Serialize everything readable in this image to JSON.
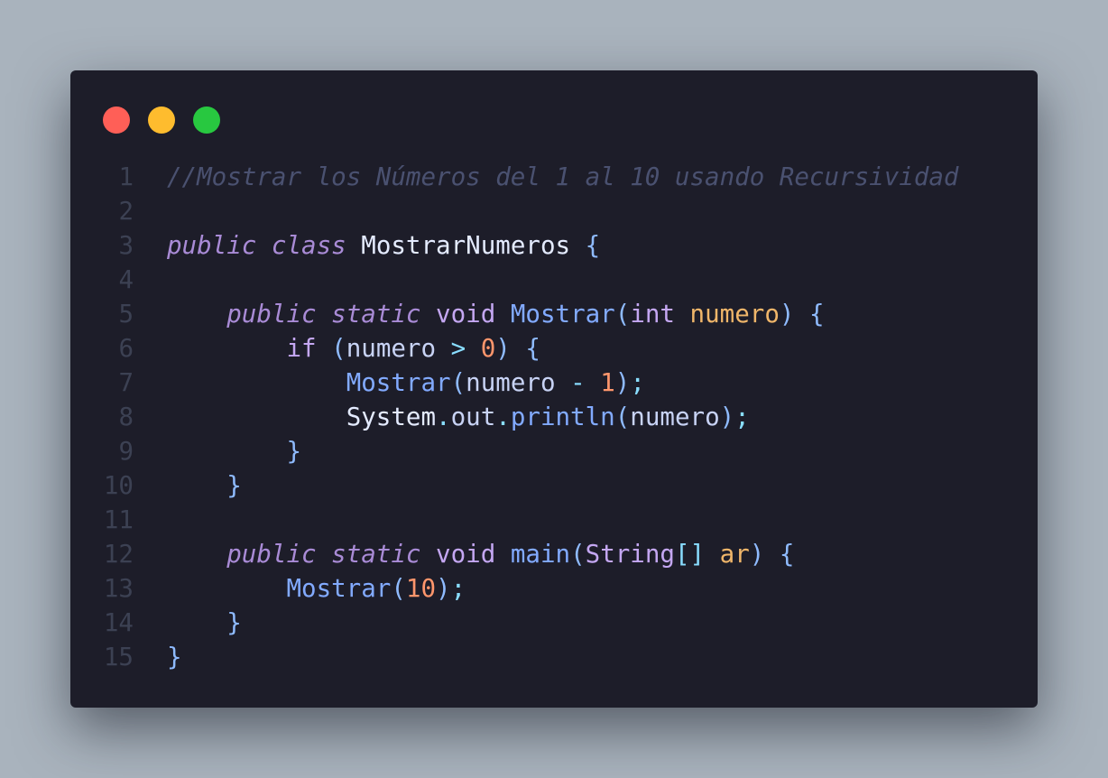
{
  "window": {
    "controls": [
      "close",
      "minimize",
      "maximize"
    ],
    "colors": {
      "background": "#1d1d29",
      "close": "#ff5f57",
      "minimize": "#febc2e",
      "maximize": "#28c840"
    }
  },
  "code": {
    "language": "java",
    "lines": [
      {
        "number": "1",
        "tokens": [
          {
            "t": "//Mostrar los Números del 1 al 10 usando Recursividad",
            "k": "comment"
          }
        ]
      },
      {
        "number": "2",
        "tokens": []
      },
      {
        "number": "3",
        "tokens": [
          {
            "t": "public",
            "k": "keyword"
          },
          {
            "t": " ",
            "k": "plain"
          },
          {
            "t": "class",
            "k": "keyword"
          },
          {
            "t": " ",
            "k": "plain"
          },
          {
            "t": "MostrarNumeros",
            "k": "class"
          },
          {
            "t": " ",
            "k": "plain"
          },
          {
            "t": "{",
            "k": "punct"
          }
        ]
      },
      {
        "number": "4",
        "tokens": []
      },
      {
        "number": "5",
        "tokens": [
          {
            "t": "    ",
            "k": "plain"
          },
          {
            "t": "public",
            "k": "keyword"
          },
          {
            "t": " ",
            "k": "plain"
          },
          {
            "t": "static",
            "k": "keyword"
          },
          {
            "t": " ",
            "k": "plain"
          },
          {
            "t": "void",
            "k": "type"
          },
          {
            "t": " ",
            "k": "plain"
          },
          {
            "t": "Mostrar",
            "k": "func"
          },
          {
            "t": "(",
            "k": "punct"
          },
          {
            "t": "int",
            "k": "type"
          },
          {
            "t": " ",
            "k": "plain"
          },
          {
            "t": "numero",
            "k": "param"
          },
          {
            "t": ")",
            "k": "punct"
          },
          {
            "t": " ",
            "k": "plain"
          },
          {
            "t": "{",
            "k": "punct"
          }
        ]
      },
      {
        "number": "6",
        "tokens": [
          {
            "t": "        ",
            "k": "plain"
          },
          {
            "t": "if",
            "k": "type"
          },
          {
            "t": " ",
            "k": "plain"
          },
          {
            "t": "(",
            "k": "punct"
          },
          {
            "t": "numero",
            "k": "plain"
          },
          {
            "t": " ",
            "k": "plain"
          },
          {
            "t": ">",
            "k": "op"
          },
          {
            "t": " ",
            "k": "plain"
          },
          {
            "t": "0",
            "k": "number"
          },
          {
            "t": ")",
            "k": "punct"
          },
          {
            "t": " ",
            "k": "plain"
          },
          {
            "t": "{",
            "k": "punct"
          }
        ]
      },
      {
        "number": "7",
        "tokens": [
          {
            "t": "            ",
            "k": "plain"
          },
          {
            "t": "Mostrar",
            "k": "func"
          },
          {
            "t": "(",
            "k": "punct"
          },
          {
            "t": "numero",
            "k": "plain"
          },
          {
            "t": " ",
            "k": "plain"
          },
          {
            "t": "-",
            "k": "op"
          },
          {
            "t": " ",
            "k": "plain"
          },
          {
            "t": "1",
            "k": "number"
          },
          {
            "t": ")",
            "k": "punct"
          },
          {
            "t": ";",
            "k": "op"
          }
        ]
      },
      {
        "number": "8",
        "tokens": [
          {
            "t": "            ",
            "k": "plain"
          },
          {
            "t": "System",
            "k": "class"
          },
          {
            "t": ".",
            "k": "op"
          },
          {
            "t": "out",
            "k": "plain"
          },
          {
            "t": ".",
            "k": "op"
          },
          {
            "t": "println",
            "k": "func"
          },
          {
            "t": "(",
            "k": "punct"
          },
          {
            "t": "numero",
            "k": "plain"
          },
          {
            "t": ")",
            "k": "punct"
          },
          {
            "t": ";",
            "k": "op"
          }
        ]
      },
      {
        "number": "9",
        "tokens": [
          {
            "t": "        ",
            "k": "plain"
          },
          {
            "t": "}",
            "k": "punct"
          }
        ]
      },
      {
        "number": "10",
        "tokens": [
          {
            "t": "    ",
            "k": "plain"
          },
          {
            "t": "}",
            "k": "punct"
          }
        ]
      },
      {
        "number": "11",
        "tokens": []
      },
      {
        "number": "12",
        "tokens": [
          {
            "t": "    ",
            "k": "plain"
          },
          {
            "t": "public",
            "k": "keyword"
          },
          {
            "t": " ",
            "k": "plain"
          },
          {
            "t": "static",
            "k": "keyword"
          },
          {
            "t": " ",
            "k": "plain"
          },
          {
            "t": "void",
            "k": "type"
          },
          {
            "t": " ",
            "k": "plain"
          },
          {
            "t": "main",
            "k": "func"
          },
          {
            "t": "(",
            "k": "punct"
          },
          {
            "t": "String",
            "k": "type"
          },
          {
            "t": "[]",
            "k": "bracket"
          },
          {
            "t": " ",
            "k": "plain"
          },
          {
            "t": "ar",
            "k": "param"
          },
          {
            "t": ")",
            "k": "punct"
          },
          {
            "t": " ",
            "k": "plain"
          },
          {
            "t": "{",
            "k": "punct"
          }
        ]
      },
      {
        "number": "13",
        "tokens": [
          {
            "t": "        ",
            "k": "plain"
          },
          {
            "t": "Mostrar",
            "k": "func"
          },
          {
            "t": "(",
            "k": "punct"
          },
          {
            "t": "10",
            "k": "number"
          },
          {
            "t": ")",
            "k": "punct"
          },
          {
            "t": ";",
            "k": "op"
          }
        ]
      },
      {
        "number": "14",
        "tokens": [
          {
            "t": "    ",
            "k": "plain"
          },
          {
            "t": "}",
            "k": "punct"
          }
        ]
      },
      {
        "number": "15",
        "tokens": [
          {
            "t": "}",
            "k": "punct"
          }
        ]
      }
    ]
  }
}
